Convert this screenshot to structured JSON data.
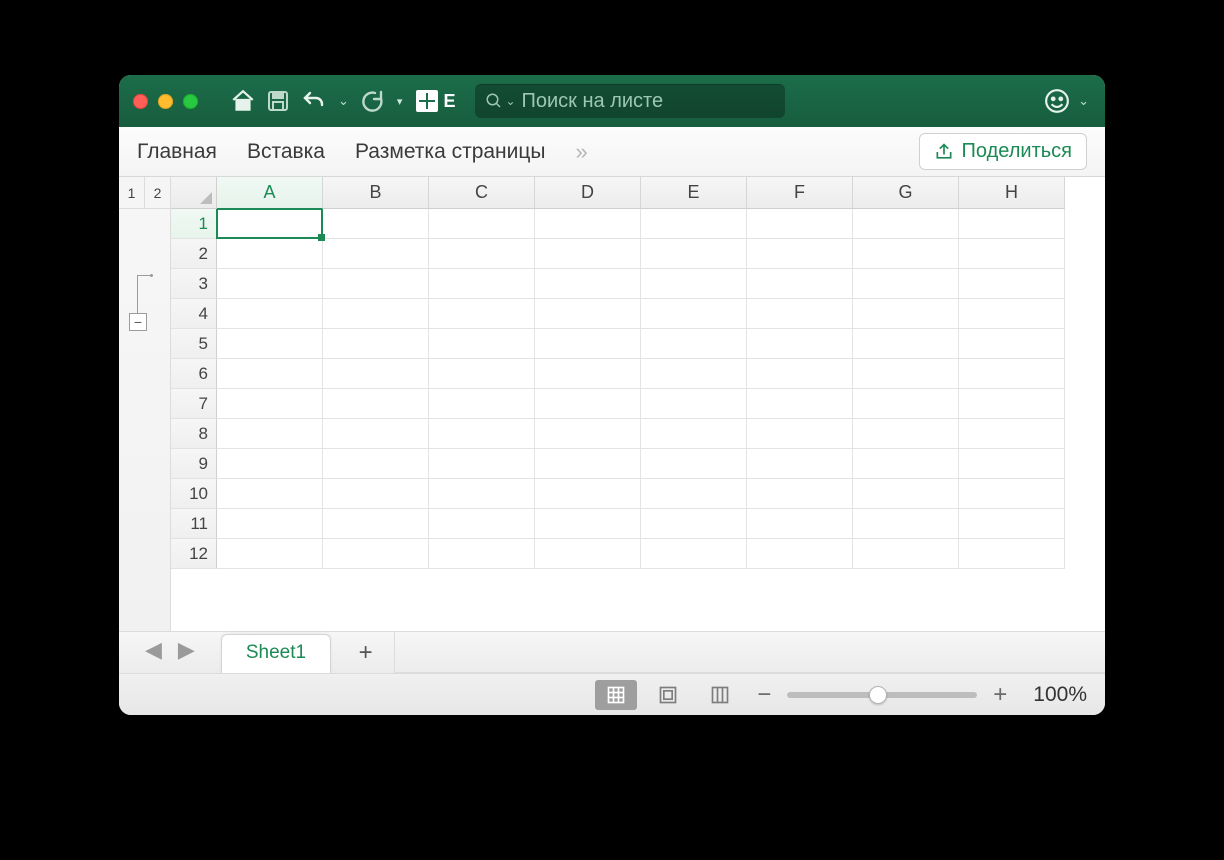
{
  "titlebar": {
    "search_placeholder": "Поиск на листе",
    "brand_letter": "E"
  },
  "ribbon": {
    "tabs": [
      "Главная",
      "Вставка",
      "Разметка страницы"
    ],
    "more": "»",
    "share_label": "Поделиться"
  },
  "outline": {
    "levels": [
      "1",
      "2"
    ],
    "collapse_symbol": "−"
  },
  "grid": {
    "columns": [
      "A",
      "B",
      "C",
      "D",
      "E",
      "F",
      "G",
      "H"
    ],
    "active_column": "A",
    "rows": [
      "1",
      "2",
      "3",
      "4",
      "5",
      "6",
      "7",
      "8",
      "9",
      "10",
      "11",
      "12"
    ],
    "active_row": "1",
    "active_cell": "A1"
  },
  "sheettabs": {
    "prev": "◀",
    "next": "▶",
    "active": "Sheet1",
    "add": "+"
  },
  "status": {
    "zoom_minus": "−",
    "zoom_plus": "+",
    "zoom_pct": "100%"
  },
  "colors": {
    "accent": "#1c8a55",
    "titlebar": "#1c6d49"
  }
}
